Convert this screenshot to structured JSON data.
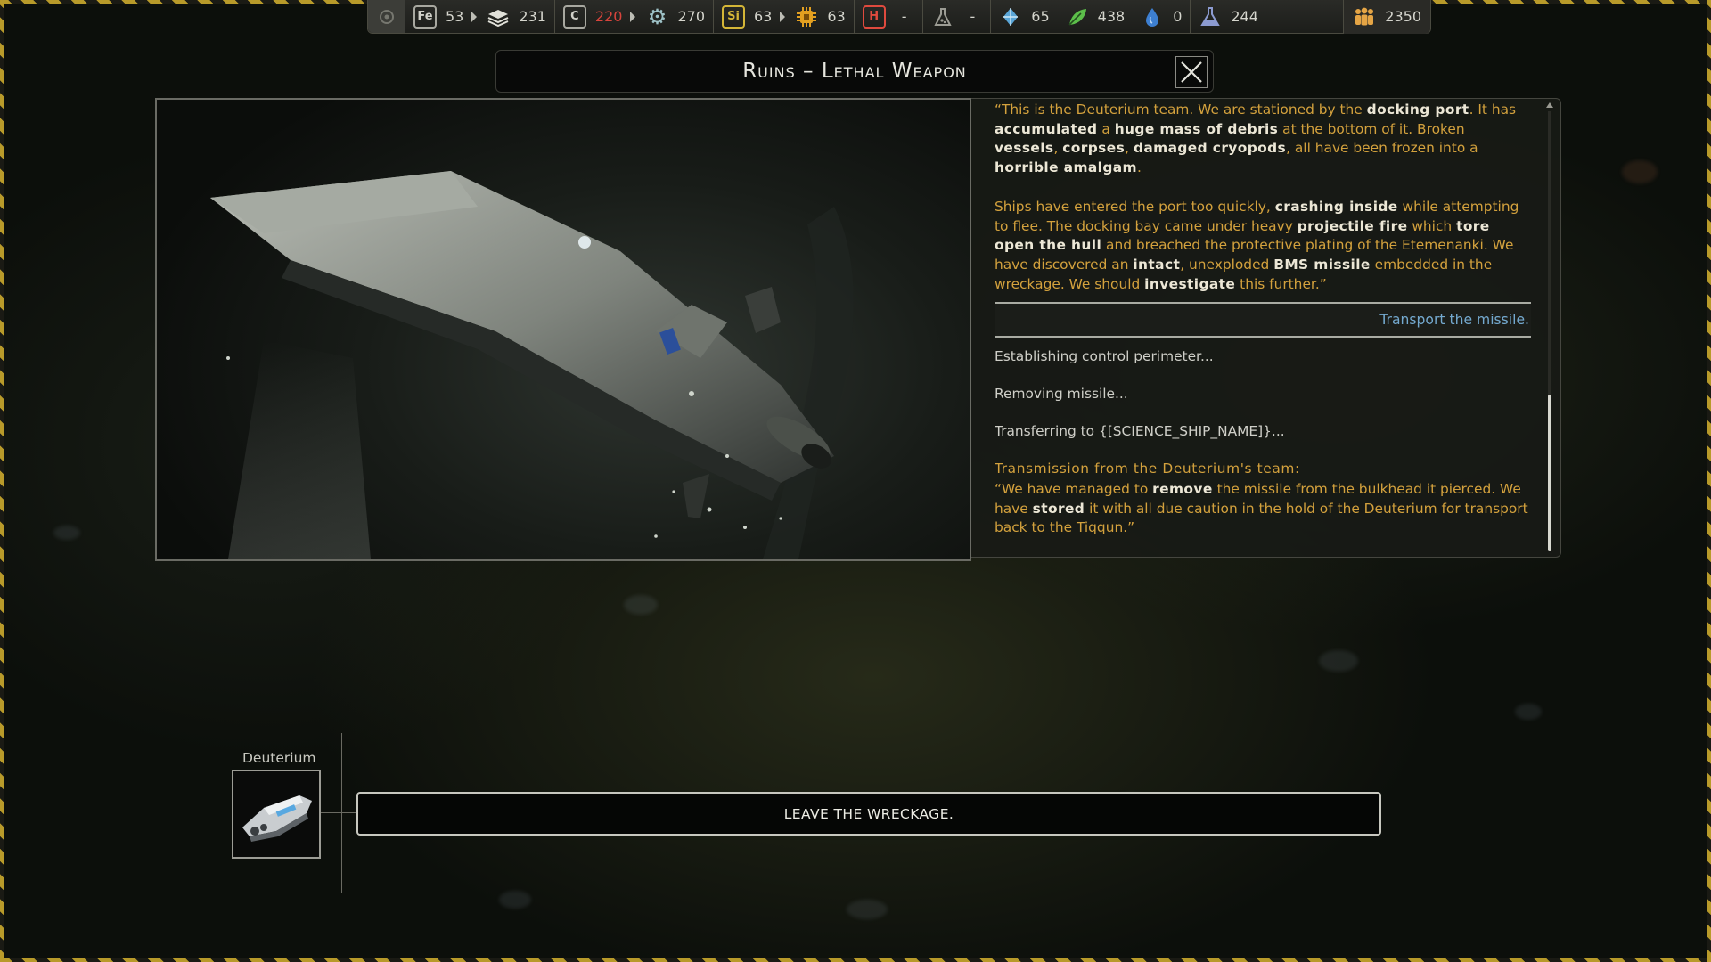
{
  "resources": [
    {
      "icon": "iron-icon",
      "glyph": "Fe",
      "value": "53"
    },
    {
      "icon": "metal-plates-icon",
      "glyph": "",
      "value": "231"
    },
    {
      "icon": "carbon-icon",
      "glyph": "C",
      "value": "220",
      "color": "#d8443c"
    },
    {
      "icon": "gear-icon",
      "glyph": "⚙",
      "value": "270"
    },
    {
      "icon": "silicon-icon",
      "glyph": "Si",
      "value": "63"
    },
    {
      "icon": "chip-icon",
      "glyph": "",
      "value": "63"
    },
    {
      "icon": "hydrogen-icon",
      "glyph": "H",
      "value": "-"
    },
    {
      "icon": "flask-cone-icon",
      "glyph": "",
      "value": "-"
    },
    {
      "icon": "crystal-icon",
      "glyph": "",
      "value": "65"
    },
    {
      "icon": "leaf-icon",
      "glyph": "",
      "value": "438"
    },
    {
      "icon": "water-drop-icon",
      "glyph": "",
      "value": "0"
    },
    {
      "icon": "science-flask-icon",
      "glyph": "",
      "value": "244"
    },
    {
      "icon": "population-icon",
      "glyph": "",
      "value": "2350"
    }
  ],
  "dialog": {
    "title": "Ruins – Lethal Weapon",
    "close_label": "✕",
    "paragraph1": [
      {
        "t": "“This is the Deuterium team. We are stationed by the ",
        "b": false
      },
      {
        "t": "docking port",
        "b": true
      },
      {
        "t": ". It has ",
        "b": false
      },
      {
        "t": "accumulated",
        "b": true
      },
      {
        "t": " a ",
        "b": false
      },
      {
        "t": "huge mass of debris",
        "b": true
      },
      {
        "t": " at the bottom of it. Broken ",
        "b": false
      },
      {
        "t": "vessels",
        "b": true
      },
      {
        "t": ", ",
        "b": false
      },
      {
        "t": "corpses",
        "b": true
      },
      {
        "t": ", ",
        "b": false
      },
      {
        "t": "damaged cryopods",
        "b": true
      },
      {
        "t": ", all have been frozen into a ",
        "b": false
      },
      {
        "t": "horrible amalgam",
        "b": true
      },
      {
        "t": ".",
        "b": false
      }
    ],
    "paragraph2": [
      {
        "t": "Ships have entered the port too quickly, ",
        "b": false
      },
      {
        "t": "crashing inside",
        "b": true
      },
      {
        "t": " while attempting to flee. The docking bay came under heavy ",
        "b": false
      },
      {
        "t": "projectile fire",
        "b": true
      },
      {
        "t": " which ",
        "b": false
      },
      {
        "t": "tore open the hull",
        "b": true
      },
      {
        "t": " and breached the protective plating of the Etemenanki. We have discovered an ",
        "b": false
      },
      {
        "t": "intact",
        "b": true
      },
      {
        "t": ", unexploded ",
        "b": false
      },
      {
        "t": "BMS missile",
        "b": true
      },
      {
        "t": " embedded in the wreckage. We should ",
        "b": false
      },
      {
        "t": "investigate",
        "b": true
      },
      {
        "t": " this further.”",
        "b": false
      }
    ],
    "choice": "Transport the missile.",
    "status1": "Establishing control perimeter...",
    "status2": "Removing missile...",
    "status3": "Transferring to {[SCIENCE_SHIP_NAME]}...",
    "transmission_header": "Transmission from the Deuterium's team:",
    "paragraph3": [
      {
        "t": "“We have managed to ",
        "b": false
      },
      {
        "t": "remove",
        "b": true
      },
      {
        "t": " the missile from the bulkhead it pierced. We have ",
        "b": false
      },
      {
        "t": "stored",
        "b": true
      },
      {
        "t": " it with all due caution in the hold of the Deuterium for transport back to the Tiqqun.”",
        "b": false
      }
    ]
  },
  "ship": {
    "name": "Deuterium"
  },
  "actions": {
    "leave": "LEAVE THE WRECKAGE."
  }
}
